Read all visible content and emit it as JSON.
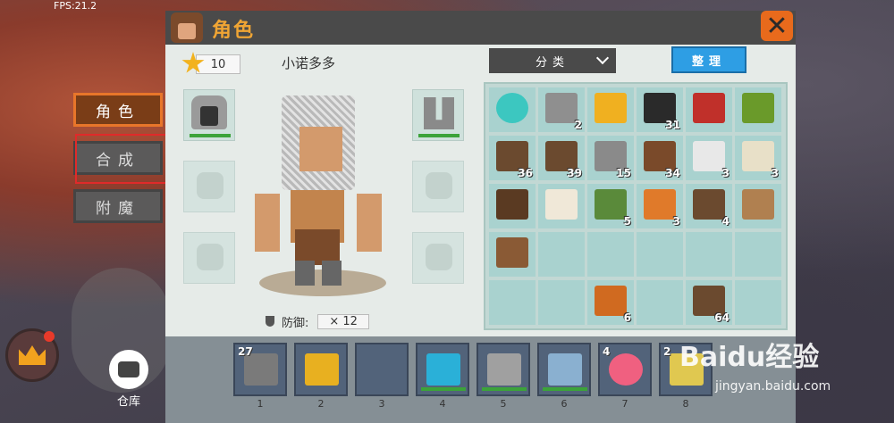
{
  "hud": {
    "fps": "FPS:21.2"
  },
  "side_tabs": [
    {
      "label": "角色",
      "active": true
    },
    {
      "label": "合成",
      "active": false
    },
    {
      "label": "附魔",
      "active": false
    }
  ],
  "storage_label": "仓库",
  "panel": {
    "title": "角色",
    "close_label": "✕",
    "level": "10",
    "player_name": "小诺多多",
    "defense_label": "防御:",
    "defense_value": "× 12",
    "sort_label": "分类",
    "tidy_label": "整理"
  },
  "equipment": [
    {
      "slot": "head",
      "item": "chainmail-helmet",
      "equipped": true,
      "durability_pct": 100
    },
    {
      "slot": "chest",
      "item": "",
      "equipped": false
    },
    {
      "slot": "legs",
      "item": "",
      "equipped": false
    },
    {
      "slot": "feet",
      "item": "chainmail-boots",
      "equipped": true,
      "durability_pct": 100
    },
    {
      "slot": "cape",
      "item": "",
      "equipped": false
    },
    {
      "slot": "mount",
      "item": "",
      "equipped": false
    }
  ],
  "inventory": [
    {
      "item": "water-orb",
      "count": "",
      "color": "#3cc7c0"
    },
    {
      "item": "stone",
      "count": "2",
      "color": "#8f8f8f"
    },
    {
      "item": "sunflower",
      "count": "",
      "color": "#f0b020"
    },
    {
      "item": "coal-ore",
      "count": "31",
      "color": "#2a2a2a"
    },
    {
      "item": "red-flower",
      "count": "",
      "color": "#c0302a"
    },
    {
      "item": "tree-sapling",
      "count": "",
      "color": "#6a9a2a"
    },
    {
      "item": "wood-block",
      "count": "36",
      "color": "#6b4a2f"
    },
    {
      "item": "wood-block",
      "count": "39",
      "color": "#6b4a2f"
    },
    {
      "item": "cobblestone",
      "count": "15",
      "color": "#8a8a8a"
    },
    {
      "item": "stick",
      "count": "34",
      "color": "#7a4a2a"
    },
    {
      "item": "string",
      "count": "3",
      "color": "#e8e8e8"
    },
    {
      "item": "bone",
      "count": "3",
      "color": "#e8e0c8"
    },
    {
      "item": "bookshelf",
      "count": "",
      "color": "#5a3a22"
    },
    {
      "item": "shell",
      "count": "",
      "color": "#f0e8d8"
    },
    {
      "item": "sugarcane",
      "count": "5",
      "color": "#5a8a3a"
    },
    {
      "item": "seeds",
      "count": "3",
      "color": "#e07a2a"
    },
    {
      "item": "wood-block",
      "count": "4",
      "color": "#6b4a2f"
    },
    {
      "item": "planks",
      "count": "",
      "color": "#b08050"
    },
    {
      "item": "boat",
      "count": "",
      "color": "#8a5a35"
    },
    {
      "item": "",
      "count": "",
      "color": ""
    },
    {
      "item": "",
      "count": "",
      "color": ""
    },
    {
      "item": "",
      "count": "",
      "color": ""
    },
    {
      "item": "",
      "count": "",
      "color": ""
    },
    {
      "item": "",
      "count": "",
      "color": ""
    },
    {
      "item": "",
      "count": "",
      "color": ""
    },
    {
      "item": "",
      "count": "",
      "color": ""
    },
    {
      "item": "pumpkin",
      "count": "6",
      "color": "#d06a20"
    },
    {
      "item": "",
      "count": "",
      "color": ""
    },
    {
      "item": "wood-block",
      "count": "64",
      "color": "#6b4a2f"
    },
    {
      "item": "",
      "count": "",
      "color": ""
    }
  ],
  "hotbar": [
    {
      "num": "1",
      "count": "27",
      "item": "stone-block",
      "color": "#7a7a7a",
      "durability_pct": 0
    },
    {
      "num": "2",
      "count": "",
      "item": "gold-pickaxe",
      "color": "#e8b020",
      "durability_pct": 0
    },
    {
      "num": "3",
      "count": "",
      "item": "",
      "color": "",
      "durability_pct": 0
    },
    {
      "num": "4",
      "count": "",
      "item": "magic-staff",
      "color": "#2ab0d8",
      "durability_pct": 100
    },
    {
      "num": "5",
      "count": "",
      "item": "stone-pickaxe",
      "color": "#a0a0a0",
      "durability_pct": 100
    },
    {
      "num": "6",
      "count": "",
      "item": "steel-sword",
      "color": "#8ab0d0",
      "durability_pct": 100
    },
    {
      "num": "7",
      "count": "4",
      "item": "candy",
      "color": "#f06080",
      "durability_pct": 0
    },
    {
      "num": "8",
      "count": "2",
      "item": "sand-block",
      "color": "#e0c850",
      "durability_pct": 0
    }
  ],
  "watermark": {
    "brand": "Baidu经验",
    "url": "jingyan.baidu.com"
  }
}
